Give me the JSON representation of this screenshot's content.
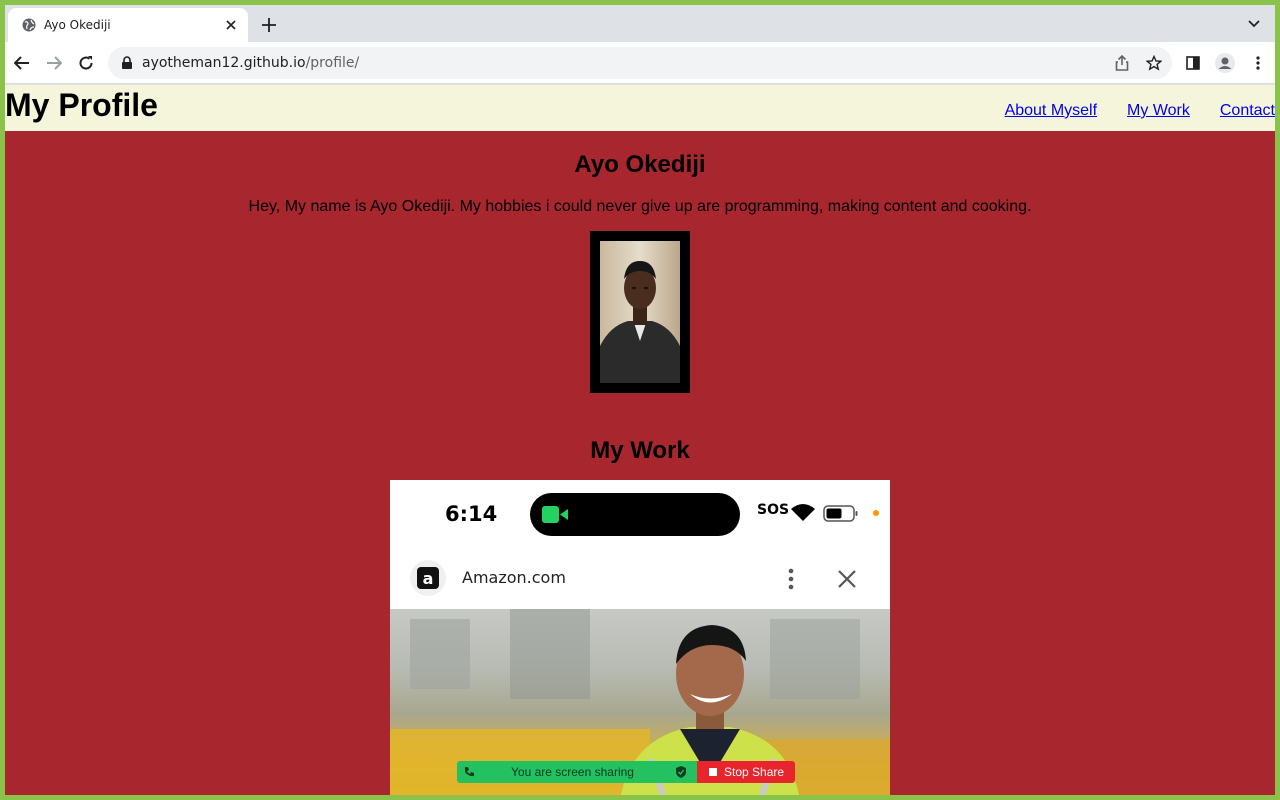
{
  "browser": {
    "tab_title": "Ayo Okediji",
    "url_host": "ayotheman12.github.io",
    "url_path": "/profile/"
  },
  "site": {
    "title": "My Profile",
    "nav": [
      "About Myself",
      "My Work",
      "Contact"
    ],
    "link_color": "#0000ee",
    "header_bg": "#f5f5dc",
    "page_bg": "#a8262d"
  },
  "profile": {
    "name": "Ayo Okediji",
    "bio": "Hey, My name is Ayo Okediji. My hobbies i could never give up are programming, making content and cooking."
  },
  "work": {
    "heading": "My Work",
    "screenshot": {
      "time": "6:14",
      "sos": "SOS",
      "app_title": "Amazon.com",
      "app_logo_letter": "a",
      "share_text": "You are screen sharing",
      "stop_text": "Stop Share"
    }
  }
}
